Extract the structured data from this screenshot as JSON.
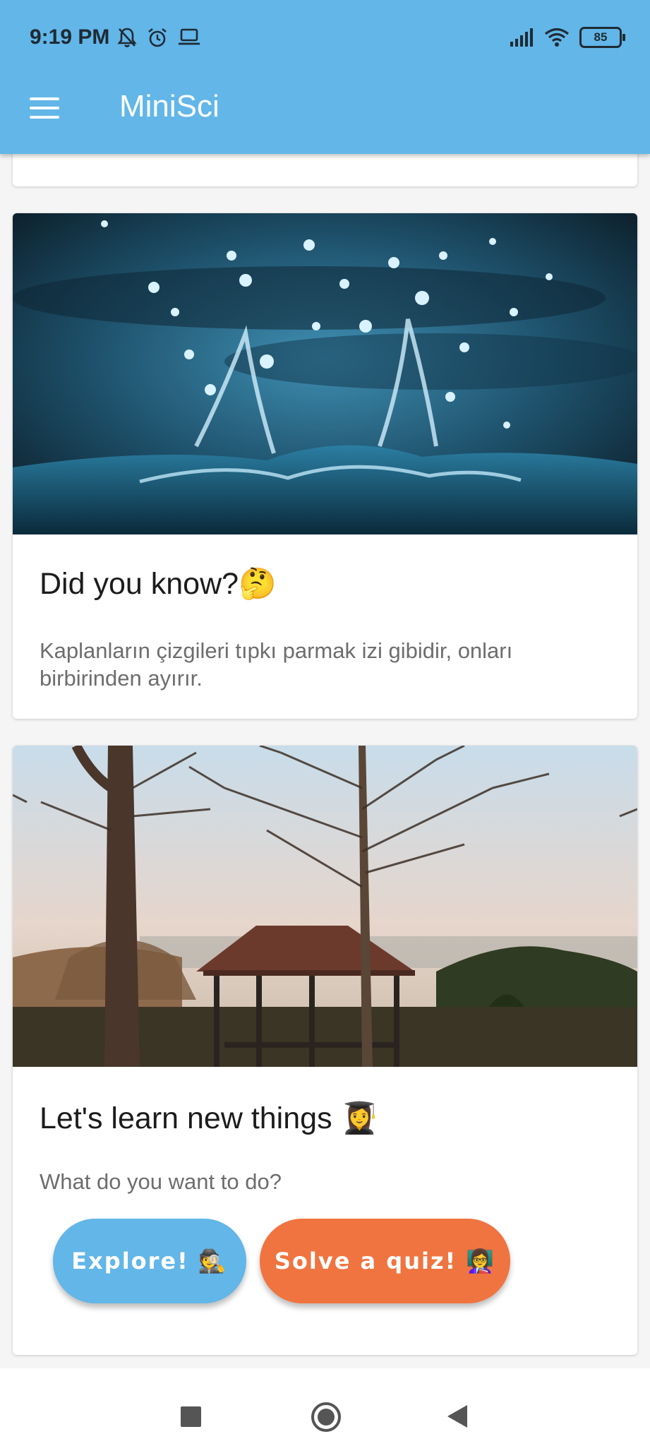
{
  "status_bar": {
    "time": "9:19 PM",
    "battery": "85",
    "icons": [
      "bell-off-icon",
      "alarm-icon",
      "laptop-icon",
      "signal-icon",
      "wifi-icon",
      "battery-icon"
    ]
  },
  "app_bar": {
    "title": "MiniSci",
    "menu_icon": "hamburger-menu-icon"
  },
  "cards": {
    "fact": {
      "image": "water-splash-photo",
      "title": "Did you know?🤔",
      "text": "Kaplanların çizgileri tıpkı parmak izi gibidir, onları birbirinden ayırır."
    },
    "learn": {
      "image": "park-gazebo-trees-photo",
      "title": "Let's learn new things 👩‍🎓",
      "prompt": "What do you want to do?",
      "explore_label": "Explore! 🕵️",
      "quiz_label": "Solve a quiz! 👩‍🏫"
    }
  },
  "colors": {
    "app_bar": "#62b6e8",
    "explore_button": "#62b6e8",
    "quiz_button": "#f07440"
  },
  "nav_bar": {
    "icons": [
      "recents-icon",
      "home-icon",
      "back-icon"
    ]
  }
}
